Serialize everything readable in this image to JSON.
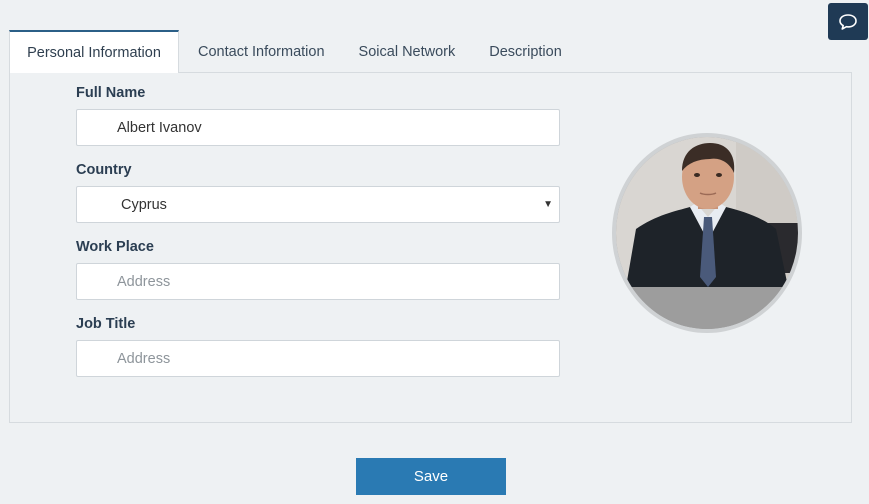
{
  "tabs": [
    {
      "label": "Personal Information"
    },
    {
      "label": "Contact Information"
    },
    {
      "label": "Soical Network"
    },
    {
      "label": "Description"
    }
  ],
  "form": {
    "full_name": {
      "label": "Full Name",
      "value": "Albert Ivanov"
    },
    "country": {
      "label": "Country",
      "value": "Cyprus"
    },
    "work_place": {
      "label": "Work Place",
      "placeholder": "Address"
    },
    "job_title": {
      "label": "Job Title",
      "placeholder": "Address"
    }
  },
  "actions": {
    "save_label": "Save"
  },
  "icons": {
    "chat": "chat-bubble-icon",
    "caret": "caret-down-icon"
  },
  "colors": {
    "accent": "#2a7ab3",
    "chat_button": "#1f3a55",
    "tab_border": "#2b5f87"
  }
}
